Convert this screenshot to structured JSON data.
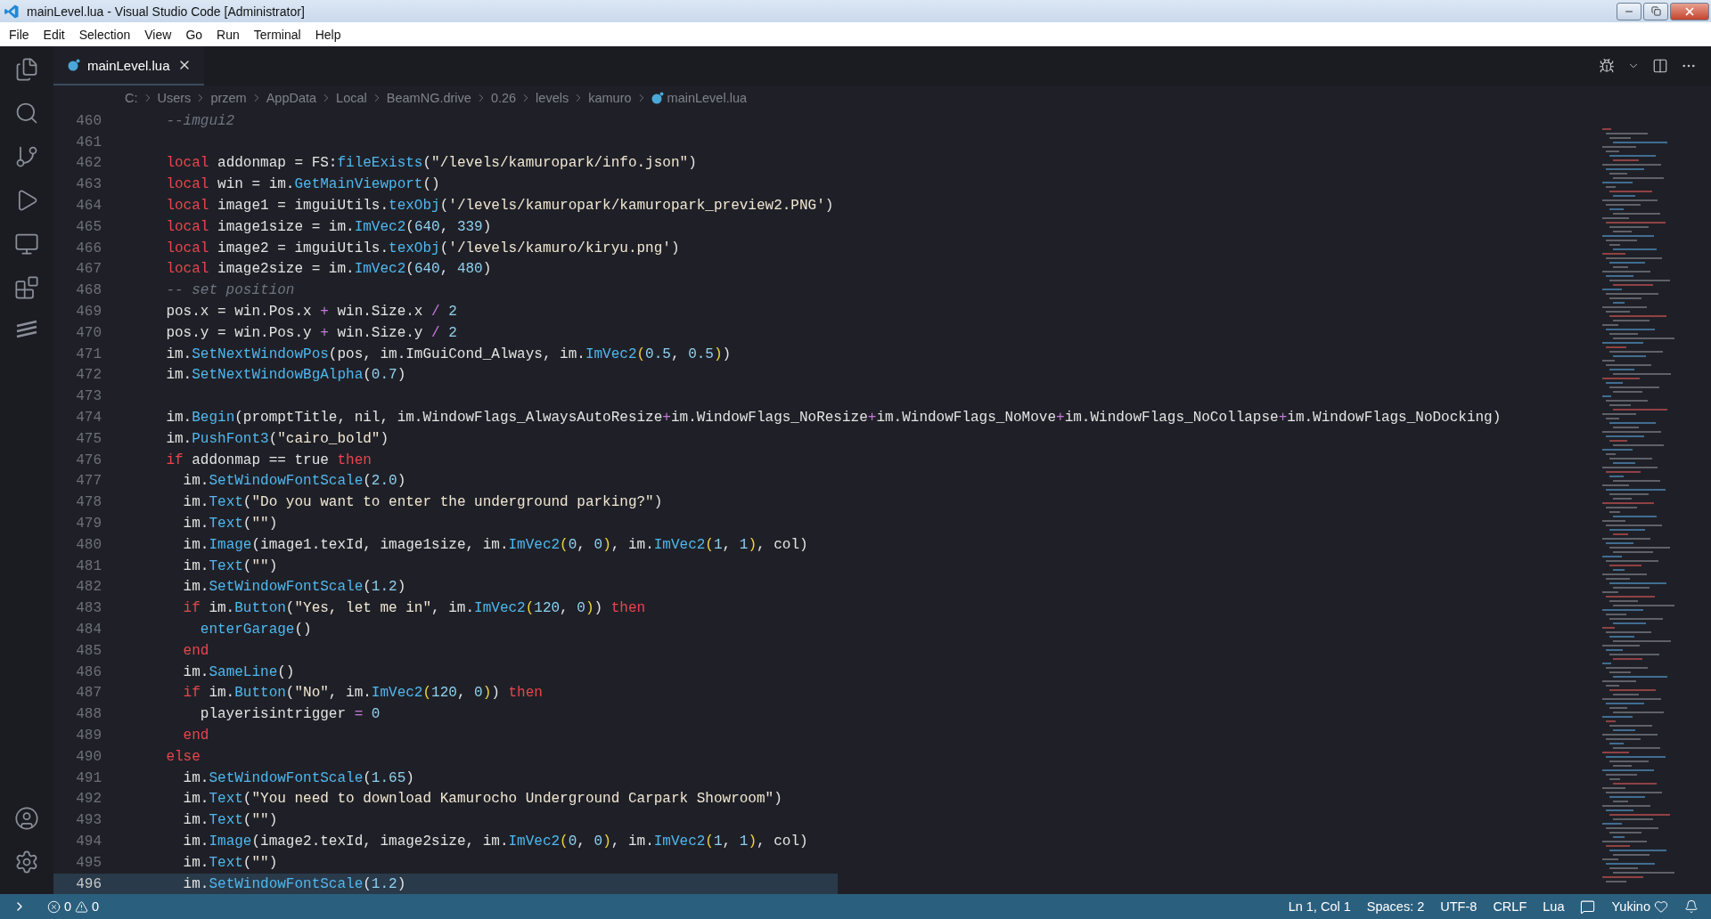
{
  "window": {
    "title": "mainLevel.lua - Visual Studio Code [Administrator]"
  },
  "menu": [
    "File",
    "Edit",
    "Selection",
    "View",
    "Go",
    "Run",
    "Terminal",
    "Help"
  ],
  "tabs": [
    {
      "label": "mainLevel.lua",
      "selected": true
    }
  ],
  "breadcrumbs": [
    "C:",
    "Users",
    "przem",
    "AppData",
    "Local",
    "BeamNG.drive",
    "0.26",
    "levels",
    "kamuro",
    "mainLevel.lua"
  ],
  "editor": {
    "lines": [
      {
        "number": "460",
        "current": false,
        "tokens": [
          {
            "kind": "cmt",
            "text": "    --imgui2"
          }
        ]
      },
      {
        "number": "461",
        "current": false
      },
      {
        "number": "462",
        "current": false,
        "tokens": [
          {
            "kind": "kw",
            "text": "    local"
          },
          {
            "kind": "plain",
            "text": " addonmap = FS:"
          },
          {
            "kind": "fn",
            "text": "fileExists"
          },
          {
            "kind": "plain",
            "text": "("
          },
          {
            "kind": "str",
            "text": "\"/levels/kamuropark/info.json\""
          },
          {
            "kind": "plain",
            "text": ")"
          }
        ]
      },
      {
        "number": "463",
        "current": false,
        "tokens": [
          {
            "kind": "kw",
            "text": "    local"
          },
          {
            "kind": "plain",
            "text": " win = im."
          },
          {
            "kind": "fn",
            "text": "GetMainViewport"
          },
          {
            "kind": "plain",
            "text": "()"
          }
        ]
      },
      {
        "number": "464",
        "current": false,
        "tokens": [
          {
            "kind": "kw",
            "text": "    local"
          },
          {
            "kind": "plain",
            "text": " image1 = imguiUtils."
          },
          {
            "kind": "fn",
            "text": "texObj"
          },
          {
            "kind": "plain",
            "text": "("
          },
          {
            "kind": "str",
            "text": "'/levels/kamuropark/kamuropark_preview2.PNG'"
          },
          {
            "kind": "plain",
            "text": ")"
          }
        ]
      },
      {
        "number": "465",
        "current": false,
        "tokens": [
          {
            "kind": "kw",
            "text": "    local"
          },
          {
            "kind": "plain",
            "text": " image1size = im."
          },
          {
            "kind": "fn",
            "text": "ImVec2"
          },
          {
            "kind": "plain",
            "text": "("
          },
          {
            "kind": "num",
            "text": "640"
          },
          {
            "kind": "plain",
            "text": ", "
          },
          {
            "kind": "num",
            "text": "339"
          },
          {
            "kind": "plain",
            "text": ")"
          }
        ]
      },
      {
        "number": "466",
        "current": false,
        "tokens": [
          {
            "kind": "kw",
            "text": "    local"
          },
          {
            "kind": "plain",
            "text": " image2 = imguiUtils."
          },
          {
            "kind": "fn",
            "text": "texObj"
          },
          {
            "kind": "plain",
            "text": "("
          },
          {
            "kind": "str",
            "text": "'/levels/kamuro/kiryu.png'"
          },
          {
            "kind": "plain",
            "text": ")"
          }
        ]
      },
      {
        "number": "467",
        "current": false,
        "tokens": [
          {
            "kind": "kw",
            "text": "    local"
          },
          {
            "kind": "plain",
            "text": " image2size = im."
          },
          {
            "kind": "fn",
            "text": "ImVec2"
          },
          {
            "kind": "plain",
            "text": "("
          },
          {
            "kind": "num",
            "text": "640"
          },
          {
            "kind": "plain",
            "text": ", "
          },
          {
            "kind": "num",
            "text": "480"
          },
          {
            "kind": "plain",
            "text": ")"
          }
        ]
      },
      {
        "number": "468",
        "current": false,
        "tokens": [
          {
            "kind": "cmt",
            "text": "    -- set position"
          }
        ]
      },
      {
        "number": "469",
        "current": false,
        "tokens": [
          {
            "kind": "plain",
            "text": "    pos.x = win.Pos.x "
          },
          {
            "kind": "op",
            "text": "+"
          },
          {
            "kind": "plain",
            "text": " win.Size.x "
          },
          {
            "kind": "op",
            "text": "/ "
          },
          {
            "kind": "num",
            "text": "2"
          }
        ]
      },
      {
        "number": "470",
        "current": false,
        "tokens": [
          {
            "kind": "plain",
            "text": "    pos.y = win.Pos.y "
          },
          {
            "kind": "op",
            "text": "+"
          },
          {
            "kind": "plain",
            "text": " win.Size.y "
          },
          {
            "kind": "op",
            "text": "/ "
          },
          {
            "kind": "num",
            "text": "2"
          }
        ]
      },
      {
        "number": "471",
        "current": false,
        "tokens": [
          {
            "kind": "plain",
            "text": "    im."
          },
          {
            "kind": "fn",
            "text": "SetNextWindowPos"
          },
          {
            "kind": "plain",
            "text": "(pos, im.ImGuiCond_Always, im."
          },
          {
            "kind": "fn",
            "text": "ImVec2"
          },
          {
            "kind": "paren",
            "text": "("
          },
          {
            "kind": "num",
            "text": "0.5"
          },
          {
            "kind": "plain",
            "text": ", "
          },
          {
            "kind": "num",
            "text": "0.5"
          },
          {
            "kind": "paren",
            "text": ")"
          },
          {
            "kind": "plain",
            "text": ")"
          }
        ]
      },
      {
        "number": "472",
        "current": false,
        "tokens": [
          {
            "kind": "plain",
            "text": "    im."
          },
          {
            "kind": "fn",
            "text": "SetNextWindowBgAlpha"
          },
          {
            "kind": "plain",
            "text": "("
          },
          {
            "kind": "num",
            "text": "0.7"
          },
          {
            "kind": "plain",
            "text": ")"
          }
        ]
      },
      {
        "number": "473",
        "current": false
      },
      {
        "number": "474",
        "current": false,
        "tokens": [
          {
            "kind": "plain",
            "text": "    im."
          },
          {
            "kind": "fn",
            "text": "Begin"
          },
          {
            "kind": "plain",
            "text": "(promptTitle, nil, im.WindowFlags_AlwaysAutoResize"
          },
          {
            "kind": "op",
            "text": "+"
          },
          {
            "kind": "plain",
            "text": "im.WindowFlags_NoResize"
          },
          {
            "kind": "op",
            "text": "+"
          },
          {
            "kind": "plain",
            "text": "im.WindowFlags_NoMove"
          },
          {
            "kind": "op",
            "text": "+"
          },
          {
            "kind": "plain",
            "text": "im.WindowFlags_NoCollapse"
          },
          {
            "kind": "op",
            "text": "+"
          },
          {
            "kind": "plain",
            "text": "im.WindowFlags_NoDocking)"
          }
        ]
      },
      {
        "number": "475",
        "current": false,
        "tokens": [
          {
            "kind": "plain",
            "text": "    im."
          },
          {
            "kind": "fn",
            "text": "PushFont3"
          },
          {
            "kind": "plain",
            "text": "("
          },
          {
            "kind": "str",
            "text": "\"cairo_bold\""
          },
          {
            "kind": "plain",
            "text": ")"
          }
        ]
      },
      {
        "number": "476",
        "current": false,
        "tokens": [
          {
            "kind": "kw",
            "text": "    if"
          },
          {
            "kind": "plain",
            "text": " addonmap == true "
          },
          {
            "kind": "kw",
            "text": "then"
          }
        ]
      },
      {
        "number": "477",
        "current": false,
        "tokens": [
          {
            "kind": "plain",
            "text": "      im."
          },
          {
            "kind": "fn",
            "text": "SetWindowFontScale"
          },
          {
            "kind": "plain",
            "text": "("
          },
          {
            "kind": "num",
            "text": "2.0"
          },
          {
            "kind": "plain",
            "text": ")"
          }
        ]
      },
      {
        "number": "478",
        "current": false,
        "tokens": [
          {
            "kind": "plain",
            "text": "      im."
          },
          {
            "kind": "fn",
            "text": "Text"
          },
          {
            "kind": "plain",
            "text": "("
          },
          {
            "kind": "str",
            "text": "\"Do you want to enter the underground parking?\""
          },
          {
            "kind": "plain",
            "text": ")"
          }
        ]
      },
      {
        "number": "479",
        "current": false,
        "tokens": [
          {
            "kind": "plain",
            "text": "      im."
          },
          {
            "kind": "fn",
            "text": "Text"
          },
          {
            "kind": "plain",
            "text": "("
          },
          {
            "kind": "str",
            "text": "\"\""
          },
          {
            "kind": "plain",
            "text": ")"
          }
        ]
      },
      {
        "number": "480",
        "current": false,
        "tokens": [
          {
            "kind": "plain",
            "text": "      im."
          },
          {
            "kind": "fn",
            "text": "Image"
          },
          {
            "kind": "plain",
            "text": "(image1.texId, image1size, im."
          },
          {
            "kind": "fn",
            "text": "ImVec2"
          },
          {
            "kind": "paren",
            "text": "("
          },
          {
            "kind": "num",
            "text": "0"
          },
          {
            "kind": "plain",
            "text": ", "
          },
          {
            "kind": "num",
            "text": "0"
          },
          {
            "kind": "paren",
            "text": ")"
          },
          {
            "kind": "plain",
            "text": ", im."
          },
          {
            "kind": "fn",
            "text": "ImVec2"
          },
          {
            "kind": "paren",
            "text": "("
          },
          {
            "kind": "num",
            "text": "1"
          },
          {
            "kind": "plain",
            "text": ", "
          },
          {
            "kind": "num",
            "text": "1"
          },
          {
            "kind": "paren",
            "text": ")"
          },
          {
            "kind": "plain",
            "text": ", col)"
          }
        ]
      },
      {
        "number": "481",
        "current": false,
        "tokens": [
          {
            "kind": "plain",
            "text": "      im."
          },
          {
            "kind": "fn",
            "text": "Text"
          },
          {
            "kind": "plain",
            "text": "("
          },
          {
            "kind": "str",
            "text": "\"\""
          },
          {
            "kind": "plain",
            "text": ")"
          }
        ]
      },
      {
        "number": "482",
        "current": false,
        "tokens": [
          {
            "kind": "plain",
            "text": "      im."
          },
          {
            "kind": "fn",
            "text": "SetWindowFontScale"
          },
          {
            "kind": "plain",
            "text": "("
          },
          {
            "kind": "num",
            "text": "1.2"
          },
          {
            "kind": "plain",
            "text": ")"
          }
        ]
      },
      {
        "number": "483",
        "current": false,
        "tokens": [
          {
            "kind": "kw",
            "text": "      if"
          },
          {
            "kind": "plain",
            "text": " im."
          },
          {
            "kind": "fn",
            "text": "Button"
          },
          {
            "kind": "plain",
            "text": "("
          },
          {
            "kind": "str",
            "text": "\"Yes, let me in\""
          },
          {
            "kind": "plain",
            "text": ", im."
          },
          {
            "kind": "fn",
            "text": "ImVec2"
          },
          {
            "kind": "paren",
            "text": "("
          },
          {
            "kind": "num",
            "text": "120"
          },
          {
            "kind": "plain",
            "text": ", "
          },
          {
            "kind": "num",
            "text": "0"
          },
          {
            "kind": "paren",
            "text": ")"
          },
          {
            "kind": "plain",
            "text": ") "
          },
          {
            "kind": "kw",
            "text": "then"
          }
        ]
      },
      {
        "number": "484",
        "current": false,
        "tokens": [
          {
            "kind": "fn",
            "text": "        enterGarage"
          },
          {
            "kind": "plain",
            "text": "()"
          }
        ]
      },
      {
        "number": "485",
        "current": false,
        "tokens": [
          {
            "kind": "kw",
            "text": "      end"
          }
        ]
      },
      {
        "number": "486",
        "current": false,
        "tokens": [
          {
            "kind": "plain",
            "text": "      im."
          },
          {
            "kind": "fn",
            "text": "SameLine"
          },
          {
            "kind": "plain",
            "text": "()"
          }
        ]
      },
      {
        "number": "487",
        "current": false,
        "tokens": [
          {
            "kind": "kw",
            "text": "      if"
          },
          {
            "kind": "plain",
            "text": " im."
          },
          {
            "kind": "fn",
            "text": "Button"
          },
          {
            "kind": "plain",
            "text": "("
          },
          {
            "kind": "str",
            "text": "\"No\""
          },
          {
            "kind": "plain",
            "text": ", im."
          },
          {
            "kind": "fn",
            "text": "ImVec2"
          },
          {
            "kind": "paren",
            "text": "("
          },
          {
            "kind": "num",
            "text": "120"
          },
          {
            "kind": "plain",
            "text": ", "
          },
          {
            "kind": "num",
            "text": "0"
          },
          {
            "kind": "paren",
            "text": ")"
          },
          {
            "kind": "plain",
            "text": ") "
          },
          {
            "kind": "kw",
            "text": "then"
          }
        ]
      },
      {
        "number": "488",
        "current": false,
        "tokens": [
          {
            "kind": "plain",
            "text": "        playerisintrigger "
          },
          {
            "kind": "op",
            "text": "= "
          },
          {
            "kind": "num",
            "text": "0"
          }
        ]
      },
      {
        "number": "489",
        "current": false,
        "tokens": [
          {
            "kind": "kw",
            "text": "      end"
          }
        ]
      },
      {
        "number": "490",
        "current": false,
        "tokens": [
          {
            "kind": "kw",
            "text": "    else"
          }
        ]
      },
      {
        "number": "491",
        "current": false,
        "tokens": [
          {
            "kind": "plain",
            "text": "      im."
          },
          {
            "kind": "fn",
            "text": "SetWindowFontScale"
          },
          {
            "kind": "plain",
            "text": "("
          },
          {
            "kind": "num",
            "text": "1.65"
          },
          {
            "kind": "plain",
            "text": ")"
          }
        ]
      },
      {
        "number": "492",
        "current": false,
        "tokens": [
          {
            "kind": "plain",
            "text": "      im."
          },
          {
            "kind": "fn",
            "text": "Text"
          },
          {
            "kind": "plain",
            "text": "("
          },
          {
            "kind": "str",
            "text": "\"You need to download Kamurocho Underground Carpark Showroom\""
          },
          {
            "kind": "plain",
            "text": ")"
          }
        ]
      },
      {
        "number": "493",
        "current": false,
        "tokens": [
          {
            "kind": "plain",
            "text": "      im."
          },
          {
            "kind": "fn",
            "text": "Text"
          },
          {
            "kind": "plain",
            "text": "("
          },
          {
            "kind": "str",
            "text": "\"\""
          },
          {
            "kind": "plain",
            "text": ")"
          }
        ]
      },
      {
        "number": "494",
        "current": false,
        "tokens": [
          {
            "kind": "plain",
            "text": "      im."
          },
          {
            "kind": "fn",
            "text": "Image"
          },
          {
            "kind": "plain",
            "text": "(image2.texId, image2size, im."
          },
          {
            "kind": "fn",
            "text": "ImVec2"
          },
          {
            "kind": "paren",
            "text": "("
          },
          {
            "kind": "num",
            "text": "0"
          },
          {
            "kind": "plain",
            "text": ", "
          },
          {
            "kind": "num",
            "text": "0"
          },
          {
            "kind": "paren",
            "text": ")"
          },
          {
            "kind": "plain",
            "text": ", im."
          },
          {
            "kind": "fn",
            "text": "ImVec2"
          },
          {
            "kind": "paren",
            "text": "("
          },
          {
            "kind": "num",
            "text": "1"
          },
          {
            "kind": "plain",
            "text": ", "
          },
          {
            "kind": "num",
            "text": "1"
          },
          {
            "kind": "paren",
            "text": ")"
          },
          {
            "kind": "plain",
            "text": ", col)"
          }
        ]
      },
      {
        "number": "495",
        "current": false,
        "tokens": [
          {
            "kind": "plain",
            "text": "      im."
          },
          {
            "kind": "fn",
            "text": "Text"
          },
          {
            "kind": "plain",
            "text": "("
          },
          {
            "kind": "str",
            "text": "\"\""
          },
          {
            "kind": "plain",
            "text": ")"
          }
        ]
      },
      {
        "number": "496",
        "current": true,
        "tokens": [
          {
            "kind": "plain",
            "text": "      im."
          },
          {
            "kind": "fn",
            "text": "SetWindowFontScale"
          },
          {
            "kind": "plain",
            "text": "("
          },
          {
            "kind": "num",
            "text": "1.2"
          },
          {
            "kind": "plain",
            "text": ")"
          }
        ]
      }
    ]
  },
  "status_bar": {
    "errors": "0",
    "warnings": "0",
    "items": [
      "Ln 1, Col 1",
      "Spaces: 2",
      "UTF-8",
      "CRLF",
      "Lua"
    ],
    "account": "Yukino"
  }
}
